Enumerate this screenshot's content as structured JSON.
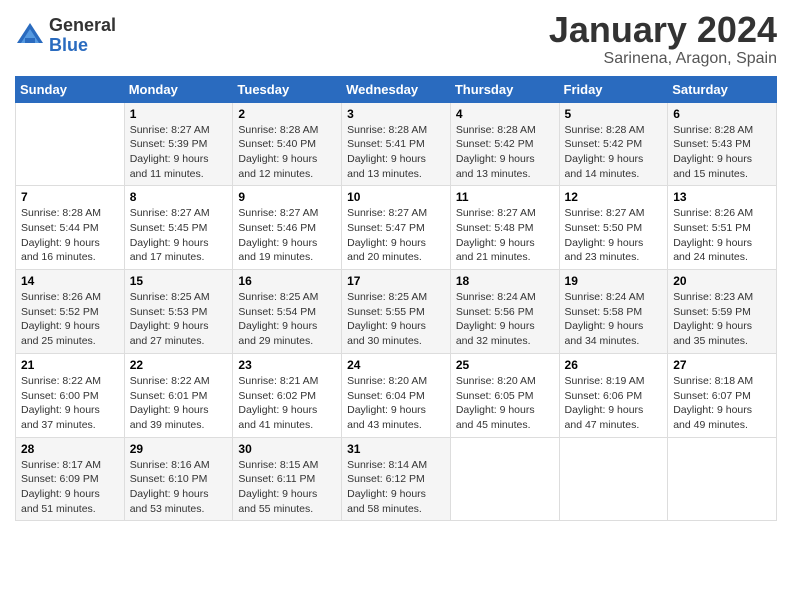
{
  "header": {
    "logo_general": "General",
    "logo_blue": "Blue",
    "month_title": "January 2024",
    "location": "Sarinena, Aragon, Spain"
  },
  "days_of_week": [
    "Sunday",
    "Monday",
    "Tuesday",
    "Wednesday",
    "Thursday",
    "Friday",
    "Saturday"
  ],
  "weeks": [
    [
      {
        "day": "",
        "sunrise": "",
        "sunset": "",
        "daylight": ""
      },
      {
        "day": "1",
        "sunrise": "Sunrise: 8:27 AM",
        "sunset": "Sunset: 5:39 PM",
        "daylight": "Daylight: 9 hours and 11 minutes."
      },
      {
        "day": "2",
        "sunrise": "Sunrise: 8:28 AM",
        "sunset": "Sunset: 5:40 PM",
        "daylight": "Daylight: 9 hours and 12 minutes."
      },
      {
        "day": "3",
        "sunrise": "Sunrise: 8:28 AM",
        "sunset": "Sunset: 5:41 PM",
        "daylight": "Daylight: 9 hours and 13 minutes."
      },
      {
        "day": "4",
        "sunrise": "Sunrise: 8:28 AM",
        "sunset": "Sunset: 5:42 PM",
        "daylight": "Daylight: 9 hours and 13 minutes."
      },
      {
        "day": "5",
        "sunrise": "Sunrise: 8:28 AM",
        "sunset": "Sunset: 5:42 PM",
        "daylight": "Daylight: 9 hours and 14 minutes."
      },
      {
        "day": "6",
        "sunrise": "Sunrise: 8:28 AM",
        "sunset": "Sunset: 5:43 PM",
        "daylight": "Daylight: 9 hours and 15 minutes."
      }
    ],
    [
      {
        "day": "7",
        "sunrise": "Sunrise: 8:28 AM",
        "sunset": "Sunset: 5:44 PM",
        "daylight": "Daylight: 9 hours and 16 minutes."
      },
      {
        "day": "8",
        "sunrise": "Sunrise: 8:27 AM",
        "sunset": "Sunset: 5:45 PM",
        "daylight": "Daylight: 9 hours and 17 minutes."
      },
      {
        "day": "9",
        "sunrise": "Sunrise: 8:27 AM",
        "sunset": "Sunset: 5:46 PM",
        "daylight": "Daylight: 9 hours and 19 minutes."
      },
      {
        "day": "10",
        "sunrise": "Sunrise: 8:27 AM",
        "sunset": "Sunset: 5:47 PM",
        "daylight": "Daylight: 9 hours and 20 minutes."
      },
      {
        "day": "11",
        "sunrise": "Sunrise: 8:27 AM",
        "sunset": "Sunset: 5:48 PM",
        "daylight": "Daylight: 9 hours and 21 minutes."
      },
      {
        "day": "12",
        "sunrise": "Sunrise: 8:27 AM",
        "sunset": "Sunset: 5:50 PM",
        "daylight": "Daylight: 9 hours and 23 minutes."
      },
      {
        "day": "13",
        "sunrise": "Sunrise: 8:26 AM",
        "sunset": "Sunset: 5:51 PM",
        "daylight": "Daylight: 9 hours and 24 minutes."
      }
    ],
    [
      {
        "day": "14",
        "sunrise": "Sunrise: 8:26 AM",
        "sunset": "Sunset: 5:52 PM",
        "daylight": "Daylight: 9 hours and 25 minutes."
      },
      {
        "day": "15",
        "sunrise": "Sunrise: 8:25 AM",
        "sunset": "Sunset: 5:53 PM",
        "daylight": "Daylight: 9 hours and 27 minutes."
      },
      {
        "day": "16",
        "sunrise": "Sunrise: 8:25 AM",
        "sunset": "Sunset: 5:54 PM",
        "daylight": "Daylight: 9 hours and 29 minutes."
      },
      {
        "day": "17",
        "sunrise": "Sunrise: 8:25 AM",
        "sunset": "Sunset: 5:55 PM",
        "daylight": "Daylight: 9 hours and 30 minutes."
      },
      {
        "day": "18",
        "sunrise": "Sunrise: 8:24 AM",
        "sunset": "Sunset: 5:56 PM",
        "daylight": "Daylight: 9 hours and 32 minutes."
      },
      {
        "day": "19",
        "sunrise": "Sunrise: 8:24 AM",
        "sunset": "Sunset: 5:58 PM",
        "daylight": "Daylight: 9 hours and 34 minutes."
      },
      {
        "day": "20",
        "sunrise": "Sunrise: 8:23 AM",
        "sunset": "Sunset: 5:59 PM",
        "daylight": "Daylight: 9 hours and 35 minutes."
      }
    ],
    [
      {
        "day": "21",
        "sunrise": "Sunrise: 8:22 AM",
        "sunset": "Sunset: 6:00 PM",
        "daylight": "Daylight: 9 hours and 37 minutes."
      },
      {
        "day": "22",
        "sunrise": "Sunrise: 8:22 AM",
        "sunset": "Sunset: 6:01 PM",
        "daylight": "Daylight: 9 hours and 39 minutes."
      },
      {
        "day": "23",
        "sunrise": "Sunrise: 8:21 AM",
        "sunset": "Sunset: 6:02 PM",
        "daylight": "Daylight: 9 hours and 41 minutes."
      },
      {
        "day": "24",
        "sunrise": "Sunrise: 8:20 AM",
        "sunset": "Sunset: 6:04 PM",
        "daylight": "Daylight: 9 hours and 43 minutes."
      },
      {
        "day": "25",
        "sunrise": "Sunrise: 8:20 AM",
        "sunset": "Sunset: 6:05 PM",
        "daylight": "Daylight: 9 hours and 45 minutes."
      },
      {
        "day": "26",
        "sunrise": "Sunrise: 8:19 AM",
        "sunset": "Sunset: 6:06 PM",
        "daylight": "Daylight: 9 hours and 47 minutes."
      },
      {
        "day": "27",
        "sunrise": "Sunrise: 8:18 AM",
        "sunset": "Sunset: 6:07 PM",
        "daylight": "Daylight: 9 hours and 49 minutes."
      }
    ],
    [
      {
        "day": "28",
        "sunrise": "Sunrise: 8:17 AM",
        "sunset": "Sunset: 6:09 PM",
        "daylight": "Daylight: 9 hours and 51 minutes."
      },
      {
        "day": "29",
        "sunrise": "Sunrise: 8:16 AM",
        "sunset": "Sunset: 6:10 PM",
        "daylight": "Daylight: 9 hours and 53 minutes."
      },
      {
        "day": "30",
        "sunrise": "Sunrise: 8:15 AM",
        "sunset": "Sunset: 6:11 PM",
        "daylight": "Daylight: 9 hours and 55 minutes."
      },
      {
        "day": "31",
        "sunrise": "Sunrise: 8:14 AM",
        "sunset": "Sunset: 6:12 PM",
        "daylight": "Daylight: 9 hours and 58 minutes."
      },
      {
        "day": "",
        "sunrise": "",
        "sunset": "",
        "daylight": ""
      },
      {
        "day": "",
        "sunrise": "",
        "sunset": "",
        "daylight": ""
      },
      {
        "day": "",
        "sunrise": "",
        "sunset": "",
        "daylight": ""
      }
    ]
  ]
}
